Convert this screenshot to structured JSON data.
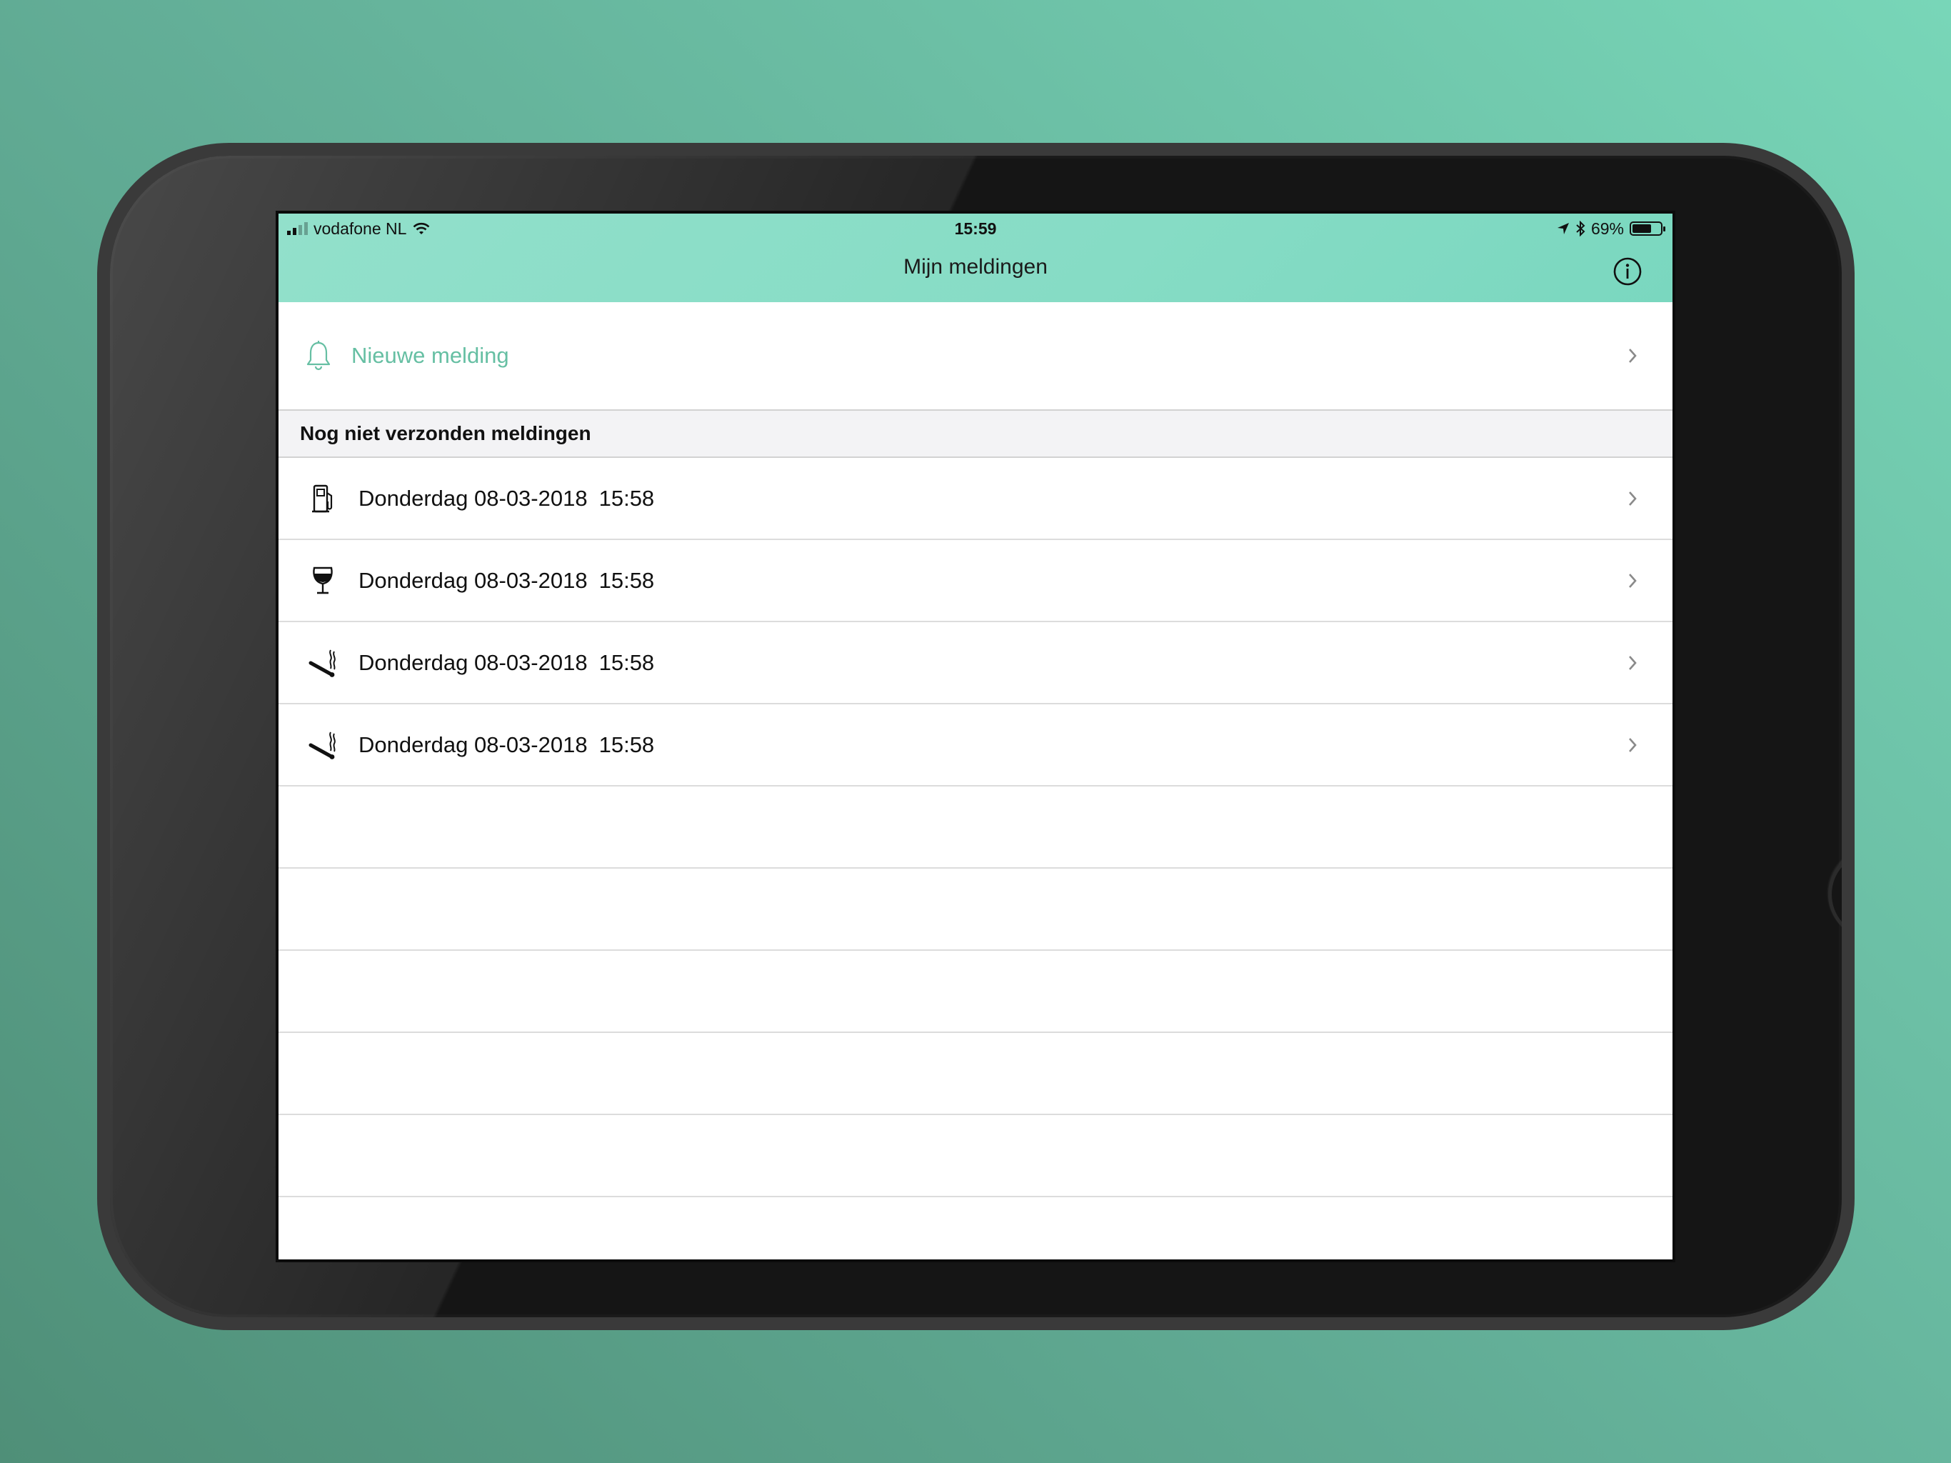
{
  "status_bar": {
    "carrier": "vodafone NL",
    "time": "15:59",
    "battery_percent": "69%",
    "battery_level": 0.69,
    "icons": [
      "signal-icon",
      "wifi-icon",
      "location-arrow-icon",
      "bluetooth-icon",
      "battery-icon"
    ]
  },
  "nav": {
    "title": "Mijn meldingen",
    "info_icon": "info-icon"
  },
  "new_report": {
    "label": "Nieuwe melding",
    "icon": "bell-icon"
  },
  "section": {
    "title": "Nog niet verzonden meldingen"
  },
  "reports": [
    {
      "icon": "fuel-pump-icon",
      "date": "Donderdag 08-03-2018",
      "time": "15:58"
    },
    {
      "icon": "wine-glass-icon",
      "date": "Donderdag 08-03-2018",
      "time": "15:58"
    },
    {
      "icon": "smoking-icon",
      "date": "Donderdag 08-03-2018",
      "time": "15:58"
    },
    {
      "icon": "smoking-icon",
      "date": "Donderdag 08-03-2018",
      "time": "15:58"
    }
  ],
  "colors": {
    "nav_background": "#86dcc5",
    "accent": "#66bfa3",
    "background_gradient_start": "#4f8f78",
    "background_gradient_end": "#78d6b8"
  }
}
